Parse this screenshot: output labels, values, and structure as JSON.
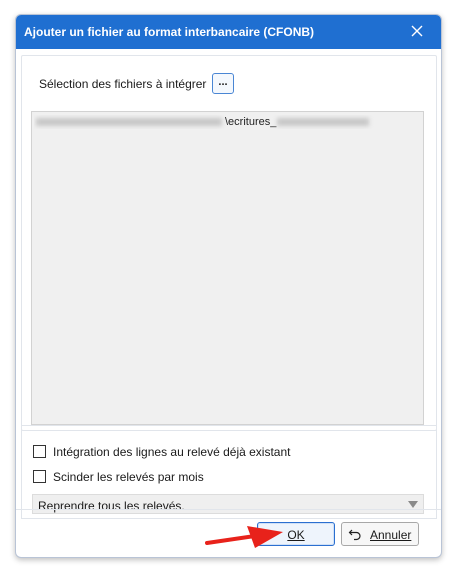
{
  "window": {
    "title": "Ajouter un fichier au format interbancaire (CFONB)"
  },
  "selection": {
    "label": "Sélection des fichiers à intégrer",
    "browse_label": "..."
  },
  "files": [
    {
      "visible_text": "\\ecritures_"
    }
  ],
  "options": {
    "integration_label": "Intégration des lignes au relevé déjà existant",
    "integration_checked": false,
    "split_label": "Scinder les relevés par mois",
    "split_checked": false,
    "dropdown_value": "Reprendre tous les relevés."
  },
  "buttons": {
    "ok": "OK",
    "cancel": "Annuler"
  },
  "icons": {
    "close": "close-icon",
    "undo": "undo-icon",
    "dropdown": "chevron-down-icon",
    "annotation": "red-arrow-annotation"
  },
  "colors": {
    "titlebar": "#1f6fd1",
    "annotation": "#e8221b",
    "ok_border": "#2b6fd0"
  }
}
